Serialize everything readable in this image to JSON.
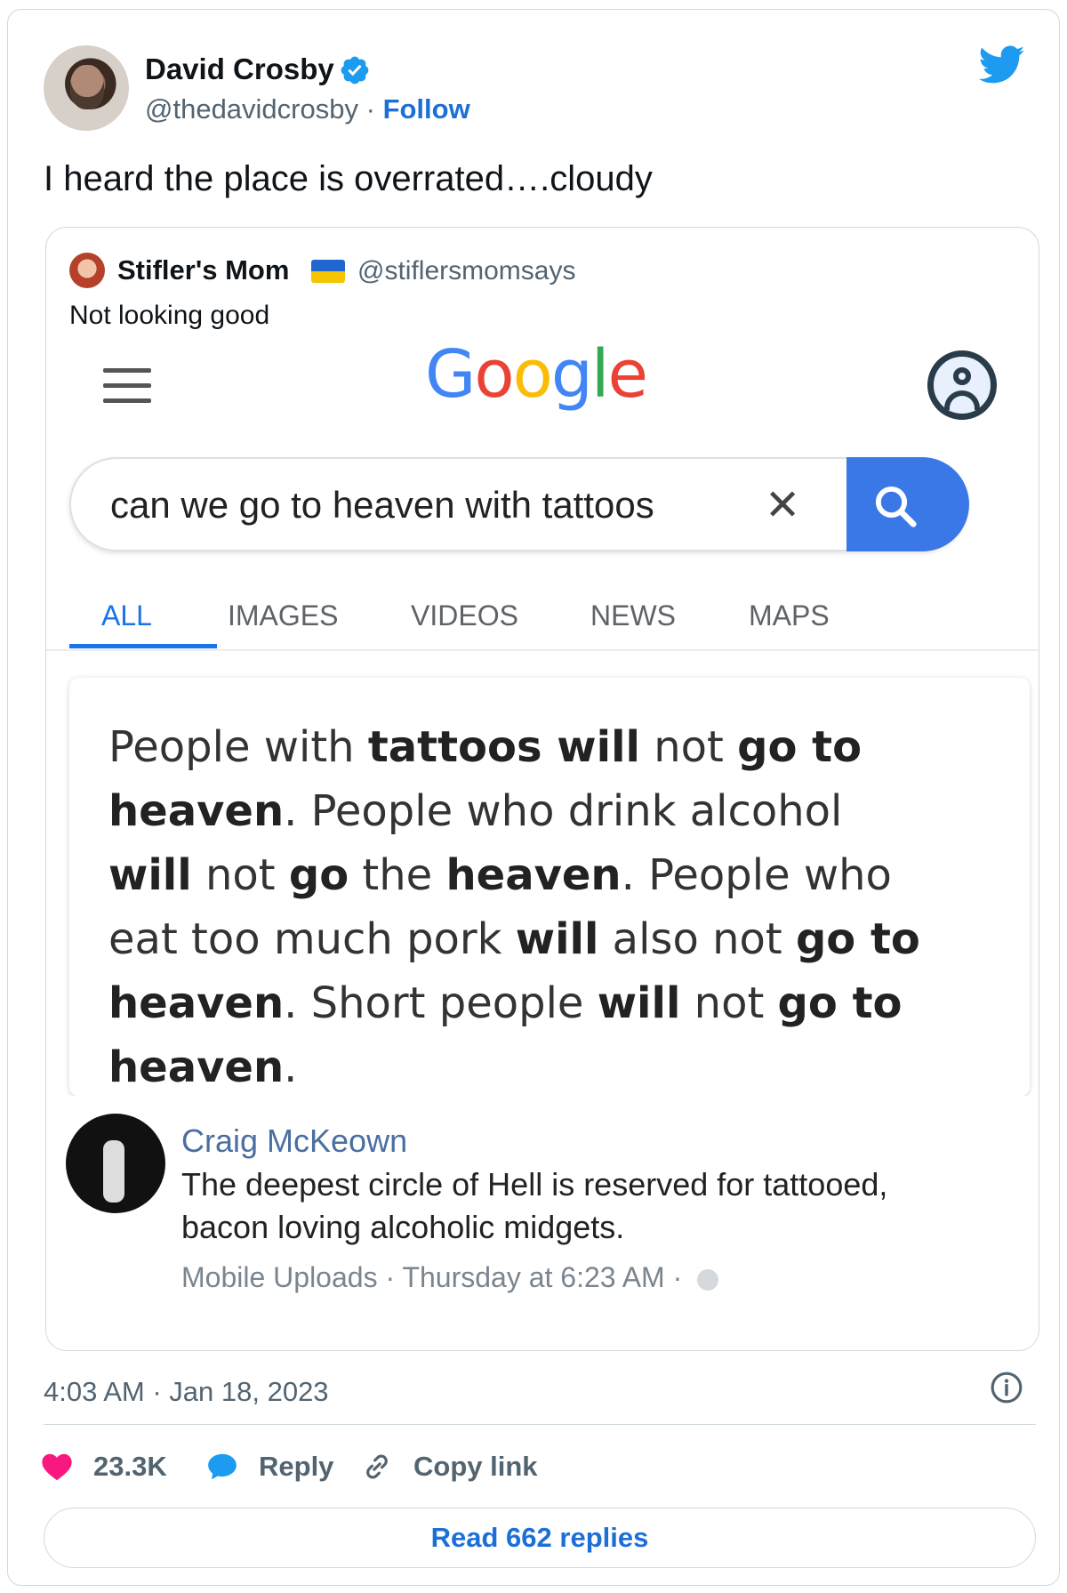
{
  "tweet": {
    "author_name": "David Crosby",
    "handle": "@thedavidcrosby",
    "separator": "·",
    "follow_label": "Follow",
    "text": "I heard the place is overrated….cloudy",
    "timestamp": "4:03 AM · Jan 18, 2023"
  },
  "quoted": {
    "author_name": "Stifler's Mom",
    "handle": "@stiflersmomsays",
    "text": "Not looking good",
    "screenshot": {
      "logo": "Google",
      "search_query": "can we go to heaven with tattoos",
      "clear_symbol": "✕",
      "tabs": [
        "ALL",
        "IMAGES",
        "VIDEOS",
        "NEWS",
        "MAPS"
      ],
      "active_tab": "ALL",
      "result_text": "People with tattoos will not go to heaven. People who drink alcohol will not go the heaven. People who eat too much pork will also not go to heaven. Short people will not go to heaven.",
      "comment": {
        "name": "Craig McKeown",
        "text": "The deepest circle of Hell is reserved for tattooed, bacon loving alcoholic midgets.",
        "meta": "Mobile Uploads · Thursday at 6:23 AM ·"
      }
    }
  },
  "actions": {
    "likes": "23.3K",
    "reply_label": "Reply",
    "copy_label": "Copy link",
    "read_replies_label": "Read 662 replies"
  },
  "colors": {
    "brand_blue": "#1d9bf0",
    "link_blue": "#1d6fd8",
    "like_pink": "#f91880",
    "google_blue": "#3b78e7"
  }
}
